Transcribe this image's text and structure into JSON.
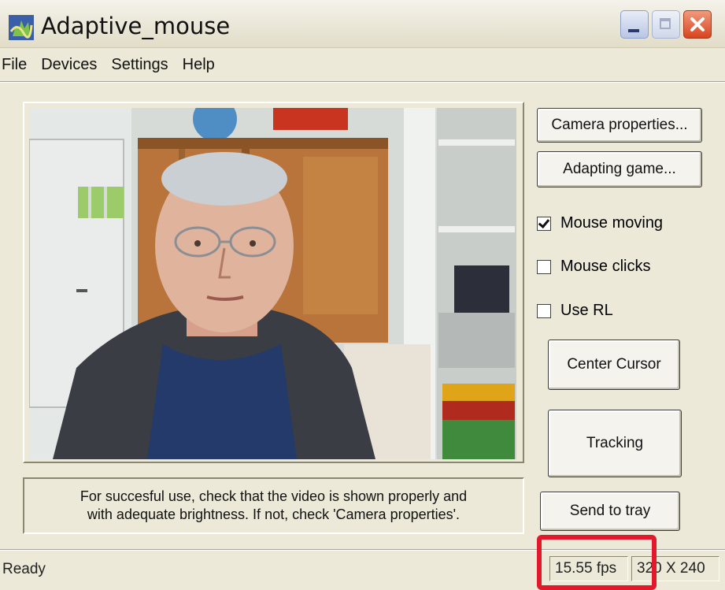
{
  "window": {
    "title": "Adaptive_mouse",
    "icon": "app-hand-icon"
  },
  "menu": [
    "File",
    "Devices",
    "Settings",
    "Help"
  ],
  "video": {
    "content": "live webcam feed"
  },
  "info_text": {
    "line1": "For succesful use, check that the video is shown properly and",
    "line2": "with adequate brightness. If not, check 'Camera properties'."
  },
  "buttons": {
    "camera_properties": "Camera properties...",
    "adapting_game": "Adapting game...",
    "center_cursor": "Center Cursor",
    "tracking": "Tracking",
    "send_to_tray": "Send to tray"
  },
  "checkboxes": [
    {
      "label": "Mouse moving",
      "checked": true
    },
    {
      "label": "Mouse clicks",
      "checked": false
    },
    {
      "label": "Use RL",
      "checked": false
    }
  ],
  "status": {
    "text": "Ready",
    "fps": "15.55 fps",
    "resolution": "320 X 240"
  },
  "colors": {
    "face": "#ece9d8",
    "highlight": "#e3182a",
    "close_button": "#d8431f"
  }
}
